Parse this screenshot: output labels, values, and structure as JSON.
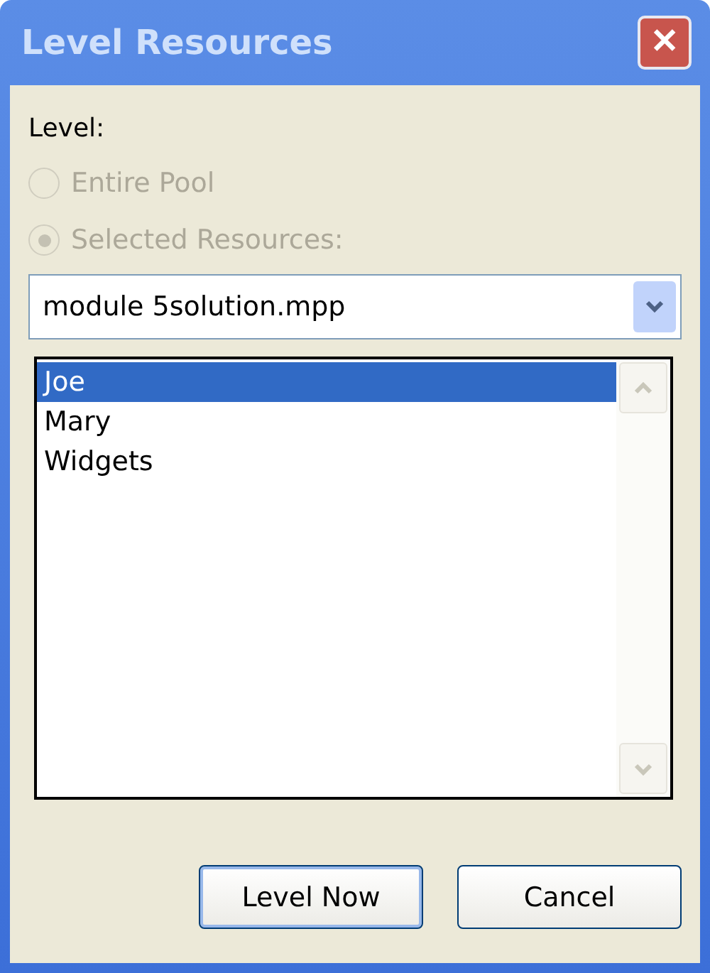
{
  "window": {
    "title": "Level Resources",
    "close_icon": "✕"
  },
  "level_label": "Level:",
  "options": [
    {
      "label": "Entire Pool",
      "selected": false,
      "disabled": true
    },
    {
      "label": "Selected Resources:",
      "selected": true,
      "disabled": true
    }
  ],
  "project_dropdown": {
    "value": "module 5solution.mpp"
  },
  "resources": [
    {
      "name": "Joe",
      "selected": true
    },
    {
      "name": "Mary",
      "selected": false
    },
    {
      "name": "Widgets",
      "selected": false
    }
  ],
  "buttons": [
    {
      "label": "Level Now",
      "default": true
    },
    {
      "label": "Cancel",
      "default": false
    }
  ]
}
